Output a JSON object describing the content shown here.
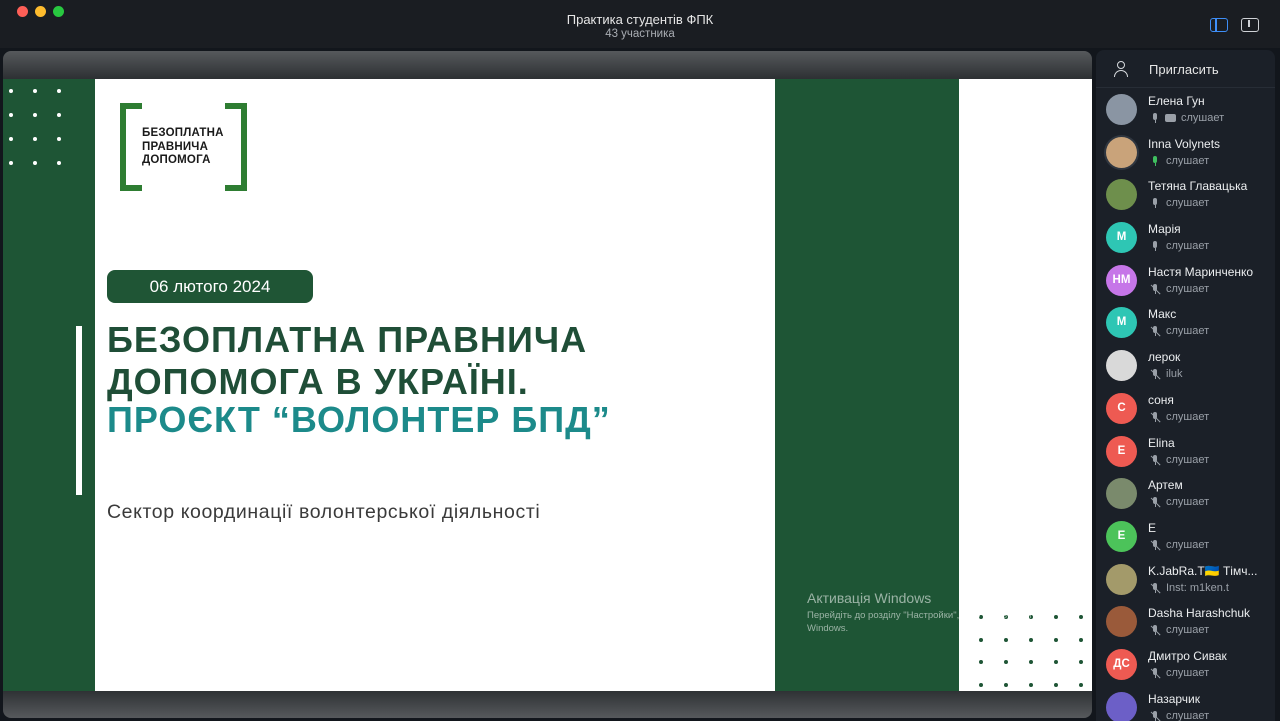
{
  "window": {
    "title": "Практика студентів ФПК",
    "subtitle": "43 участника"
  },
  "colors": {
    "slide_green": "#1e5535",
    "accent_teal": "#1c8a8a",
    "sidebar_bg": "#1b2028"
  },
  "slide": {
    "logo_lines": [
      "БЕЗОПЛАТНА",
      "ПРАВНИЧА",
      "ДОПОМОГА"
    ],
    "date": "06 лютого 2024",
    "heading_line1": "БЕЗОПЛАТНА ПРАВНИЧА",
    "heading_line2": "ДОПОМОГА В УКРАЇНІ.",
    "heading_line3": "ПРОЄКТ “ВОЛОНТЕР БПД”",
    "subheading": "Сектор координації волонтерської діяльності",
    "watermark_title": "Активація Windows",
    "watermark_text": "Перейдіть до розділу \"Настройки\", щоб активувати Windows."
  },
  "sidebar": {
    "invite_label": "Пригласить",
    "participants": [
      {
        "name": "Елена Гун",
        "status": "слушает",
        "initials": "",
        "avatar_color": "#8a95a3",
        "muted": false,
        "screen": true
      },
      {
        "name": "Inna Volynets",
        "status": "слушает",
        "initials": "",
        "avatar_color": "#c9a37a",
        "muted": false,
        "active": true
      },
      {
        "name": "Тетяна Главацька",
        "status": "слушает",
        "initials": "",
        "avatar_color": "#6e8f4c",
        "muted": false
      },
      {
        "name": "Марія",
        "status": "слушает",
        "initials": "М",
        "avatar_color": "#2ec6b4",
        "muted": false
      },
      {
        "name": "Настя Маринченко",
        "status": "слушает",
        "initials": "НМ",
        "avatar_color": "#c676e8",
        "muted": true
      },
      {
        "name": "Макс",
        "status": "слушает",
        "initials": "М",
        "avatar_color": "#2ec6b4",
        "muted": true
      },
      {
        "name": "лерок",
        "status": "iluk",
        "initials": "",
        "avatar_color": "#d9d9d9",
        "muted": true
      },
      {
        "name": "соня",
        "status": "слушает",
        "initials": "С",
        "avatar_color": "#ee5a52",
        "muted": true
      },
      {
        "name": "Elina",
        "status": "слушает",
        "initials": "E",
        "avatar_color": "#ee5a52",
        "muted": true
      },
      {
        "name": "Артем",
        "status": "слушает",
        "initials": "",
        "avatar_color": "#7a8a6c",
        "muted": true
      },
      {
        "name": "E",
        "status": "слушает",
        "initials": "E",
        "avatar_color": "#4cc35a",
        "muted": true
      },
      {
        "name": "K.JabRa.T🇺🇦 Тімч...",
        "status": "Inst: m1ken.t",
        "initials": "",
        "avatar_color": "#a39a6a",
        "muted": true
      },
      {
        "name": "Dasha Harashchuk",
        "status": "слушает",
        "initials": "",
        "avatar_color": "#9a5a3a",
        "muted": true
      },
      {
        "name": "Дмитро Сивак",
        "status": "слушает",
        "initials": "ДС",
        "avatar_color": "#ee5a52",
        "muted": true
      },
      {
        "name": "Назарчик",
        "status": "слушает",
        "initials": "",
        "avatar_color": "#6c5fc7",
        "muted": true
      }
    ]
  }
}
